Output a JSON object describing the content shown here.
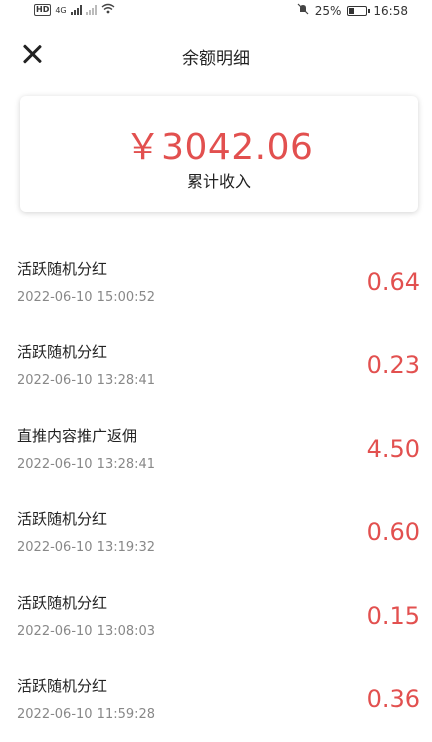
{
  "status_bar": {
    "network": "4G",
    "battery": "25%",
    "time": "16:58"
  },
  "header": {
    "title": "余额明细"
  },
  "summary": {
    "amount": "￥3042.06",
    "label": "累计收入"
  },
  "transactions": [
    {
      "title": "活跃随机分红",
      "time": "2022-06-10 15:00:52",
      "amount": "0.64"
    },
    {
      "title": "活跃随机分红",
      "time": "2022-06-10 13:28:41",
      "amount": "0.23"
    },
    {
      "title": "直推内容推广返佣",
      "time": "2022-06-10 13:28:41",
      "amount": "4.50"
    },
    {
      "title": "活跃随机分红",
      "time": "2022-06-10 13:19:32",
      "amount": "0.60"
    },
    {
      "title": "活跃随机分红",
      "time": "2022-06-10 13:08:03",
      "amount": "0.15"
    },
    {
      "title": "活跃随机分红",
      "time": "2022-06-10 11:59:28",
      "amount": "0.36"
    }
  ],
  "colors": {
    "accent": "#e2504f"
  }
}
